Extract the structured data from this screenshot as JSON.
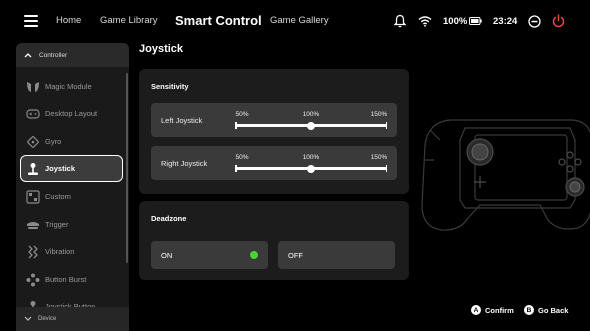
{
  "nav": {
    "items": [
      {
        "label": "Home",
        "active": false
      },
      {
        "label": "Game Library",
        "active": false
      },
      {
        "label": "Smart Control",
        "active": true
      },
      {
        "label": "Game Gallery",
        "active": false
      }
    ]
  },
  "status": {
    "battery": "100%",
    "time": "23:24",
    "icons": [
      "bell-icon",
      "wifi-icon",
      "battery-icon",
      "display-icon",
      "power-icon"
    ],
    "power_color": "#e8453c"
  },
  "sidebar": {
    "section": "Controller",
    "items": [
      {
        "label": "Magic Module",
        "icon": "magic-module-icon"
      },
      {
        "label": "Desktop Layout",
        "icon": "gamepad-icon"
      },
      {
        "label": "Gyro",
        "icon": "gyro-icon"
      },
      {
        "label": "Joystick",
        "icon": "joystick-icon",
        "active": true
      },
      {
        "label": "Custom",
        "icon": "custom-icon"
      },
      {
        "label": "Trigger",
        "icon": "trigger-icon"
      },
      {
        "label": "Vibration",
        "icon": "vibration-icon"
      },
      {
        "label": "Button Burst",
        "icon": "button-burst-icon"
      },
      {
        "label": "Joystick Button",
        "icon": "joystick-button-icon"
      }
    ],
    "footer": "Device"
  },
  "main": {
    "title": "Joystick",
    "sensitivity": {
      "title": "Sensitivity",
      "rows": [
        {
          "label": "Left Joystick",
          "min": "50%",
          "mid": "100%",
          "max": "150%",
          "value": 100
        },
        {
          "label": "Right Joystick",
          "min": "50%",
          "mid": "100%",
          "max": "150%",
          "value": 100
        }
      ]
    },
    "deadzone": {
      "title": "Deadzone",
      "on_label": "ON",
      "off_label": "OFF",
      "selected": "ON",
      "indicator_color": "#4cd137"
    }
  },
  "hints": {
    "confirm_glyph": "A",
    "confirm_label": "Confirm",
    "back_glyph": "B",
    "back_label": "Go Back"
  }
}
